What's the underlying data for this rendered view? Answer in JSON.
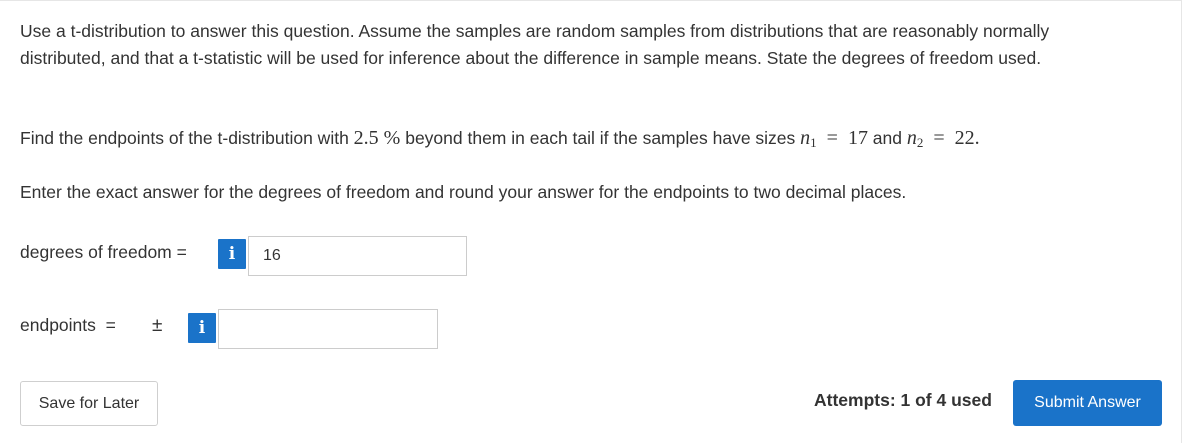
{
  "question": {
    "intro": "Use a t-distribution to answer this question. Assume the samples are random samples from distributions that are reasonably normally distributed, and that a t-statistic will be used for inference about the difference in sample means. State the degrees of freedom used.",
    "find_prefix": "Find the endpoints of the t-distribution with ",
    "percent_value": "2.5",
    "percent_sign": "%",
    "find_middle": " beyond them in each tail if the samples have sizes ",
    "n1_symbol": "n",
    "n1_sub": "1",
    "n1_value": "17",
    "and_word": " and ",
    "n2_symbol": "n",
    "n2_sub": "2",
    "n2_value": "22.",
    "equals": "=",
    "instructions": "Enter the exact answer for the degrees of freedom and round your answer for the endpoints to two decimal places."
  },
  "fields": {
    "df_label": "degrees of freedom =",
    "df_value": "16",
    "endpoints_label": "endpoints",
    "endpoints_equals": "=",
    "plus_minus": "±",
    "endpoints_value": "",
    "info_glyph": "i"
  },
  "footer": {
    "save_label": "Save for Later",
    "attempts_text": "Attempts: 1 of 4 used",
    "submit_label": "Submit Answer"
  },
  "colors": {
    "accent": "#1a73c9",
    "text": "#333333",
    "border": "#cccccc"
  },
  "icons": {
    "info": "info-icon"
  }
}
